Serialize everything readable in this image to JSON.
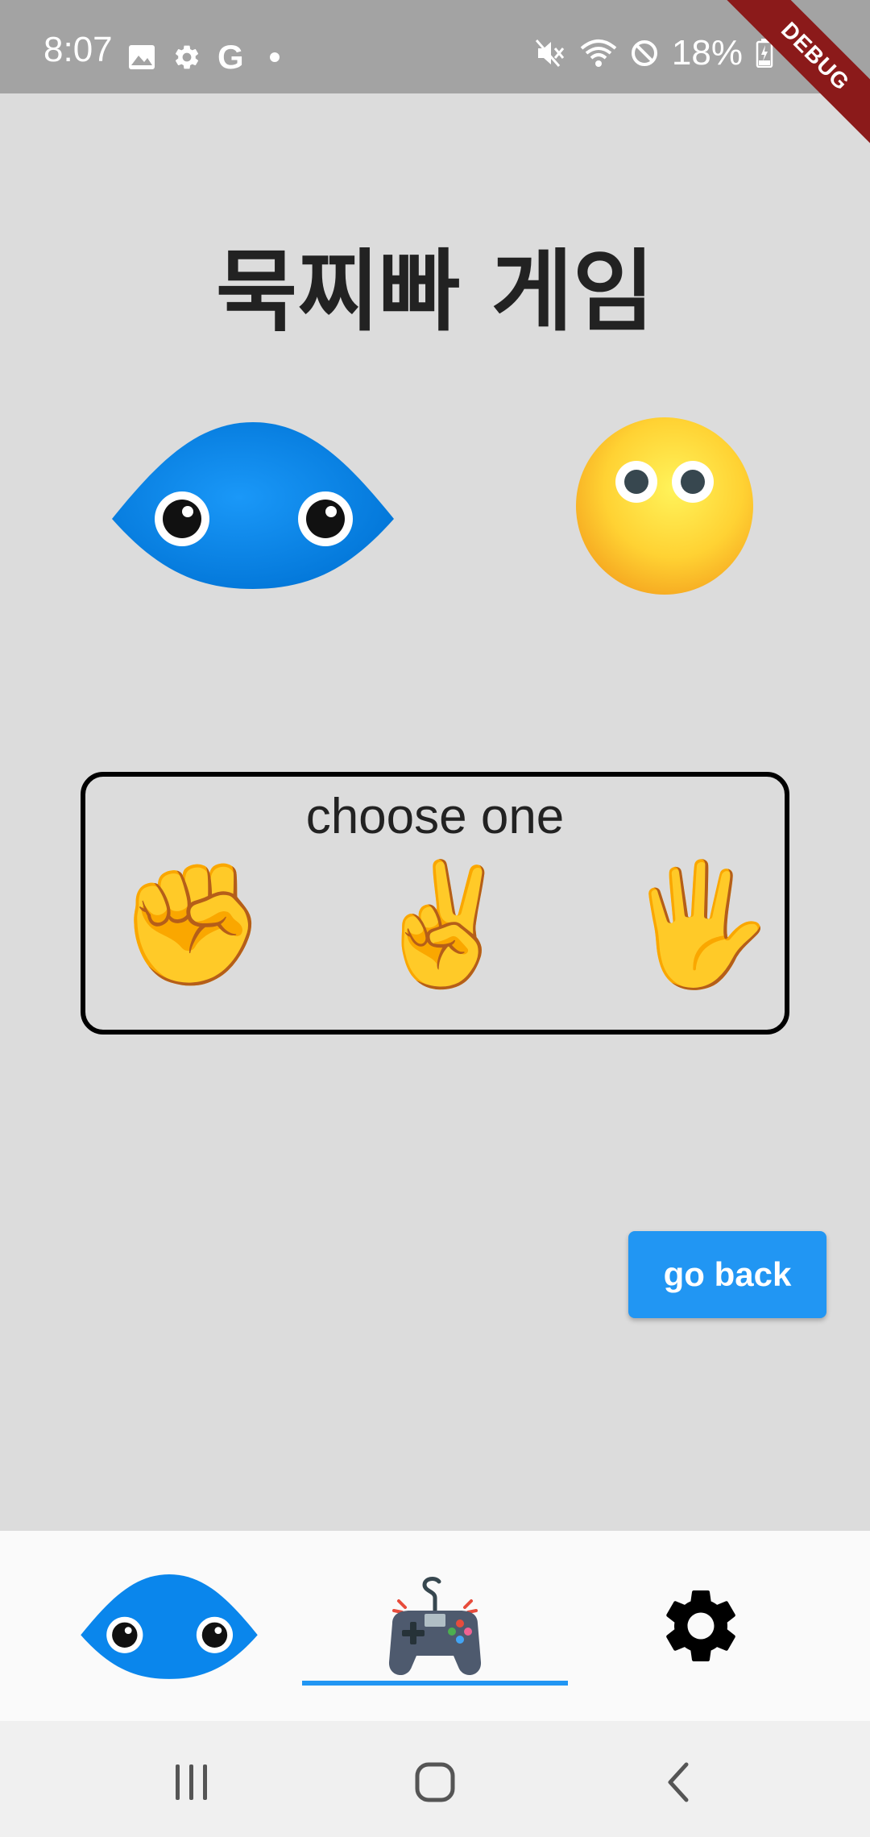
{
  "status_bar": {
    "time": "8:07",
    "battery": "18%",
    "left_icons": [
      "image-icon",
      "gear-icon",
      "google-icon",
      "dot-icon"
    ],
    "right_icons": [
      "mute-icon",
      "wifi-icon",
      "block-icon",
      "battery-icon"
    ]
  },
  "debug_banner": "DEBUG",
  "title": "묵찌빠 게임",
  "choose": {
    "title": "choose one",
    "options": [
      "✊",
      "✌️",
      "🖐️"
    ]
  },
  "go_back_label": "go back",
  "tabs": {
    "selected": 1,
    "icons": [
      "blob-icon",
      "gamepad-icon",
      "gear-icon"
    ]
  },
  "nav": {
    "icons": [
      "recent-apps-icon",
      "home-icon",
      "back-icon"
    ]
  },
  "colors": {
    "background": "#dcdcdc",
    "accent": "#2196f3",
    "status_bar": "#a3a3a3",
    "debug": "#8b1a1a"
  }
}
